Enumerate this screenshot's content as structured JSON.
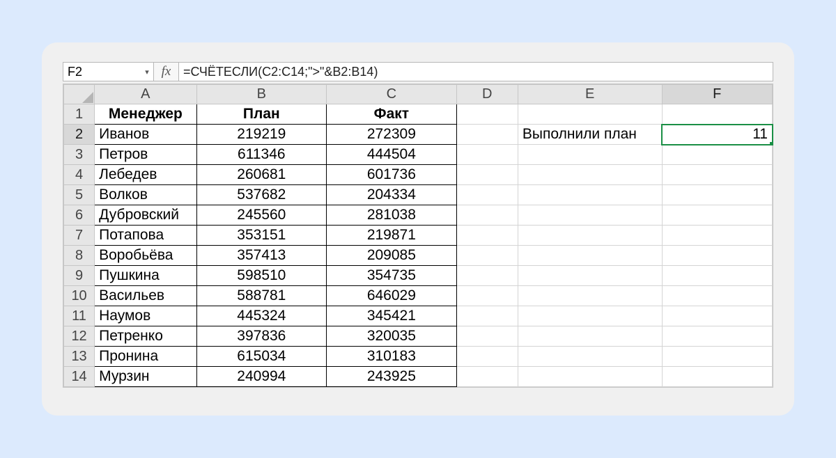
{
  "name_box": "F2",
  "formula": "=СЧЁТЕСЛИ(C2:C14;\">\"&B2:B14)",
  "columns": [
    "A",
    "B",
    "C",
    "D",
    "E",
    "F"
  ],
  "row_numbers": [
    1,
    2,
    3,
    4,
    5,
    6,
    7,
    8,
    9,
    10,
    11,
    12,
    13,
    14
  ],
  "headers": {
    "A": "Менеджер",
    "B": "План",
    "C": "Факт"
  },
  "rows": [
    {
      "name": "Иванов",
      "plan": "219219",
      "fact": "272309"
    },
    {
      "name": "Петров",
      "plan": "611346",
      "fact": "444504"
    },
    {
      "name": "Лебедев",
      "plan": "260681",
      "fact": "601736"
    },
    {
      "name": "Волков",
      "plan": "537682",
      "fact": "204334"
    },
    {
      "name": "Дубровский",
      "plan": "245560",
      "fact": "281038"
    },
    {
      "name": "Потапова",
      "plan": "353151",
      "fact": "219871"
    },
    {
      "name": "Воробьёва",
      "plan": "357413",
      "fact": "209085"
    },
    {
      "name": "Пушкина",
      "plan": "598510",
      "fact": "354735"
    },
    {
      "name": "Васильев",
      "plan": "588781",
      "fact": "646029"
    },
    {
      "name": "Наумов",
      "plan": "445324",
      "fact": "345421"
    },
    {
      "name": "Петренко",
      "plan": "397836",
      "fact": "320035"
    },
    {
      "name": "Пронина",
      "plan": "615034",
      "fact": "310183"
    },
    {
      "name": "Мурзин",
      "plan": "240994",
      "fact": "243925"
    }
  ],
  "side": {
    "E2": "Выполнили план",
    "F2": "11"
  },
  "selected_cell": "F2"
}
